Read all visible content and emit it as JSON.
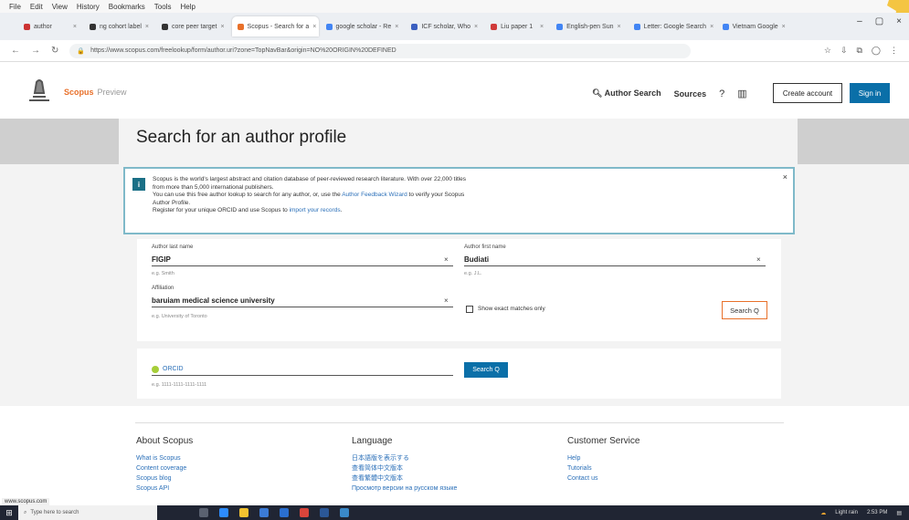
{
  "browser": {
    "menu": [
      "File",
      "Edit",
      "View",
      "History",
      "Bookmarks",
      "Tools",
      "Help"
    ],
    "tabs": [
      {
        "label": "author",
        "active": false
      },
      {
        "label": "ng cohort label",
        "active": false
      },
      {
        "label": "core peer target",
        "active": false
      },
      {
        "label": "Scopus - Search for a",
        "active": true
      },
      {
        "label": "google scholar - Re",
        "active": false
      },
      {
        "label": "ICF scholar, Who",
        "active": false
      },
      {
        "label": "Liu paper 1",
        "active": false
      },
      {
        "label": "English-pen Sun",
        "active": false
      },
      {
        "label": "Letter: Google Search",
        "active": false
      },
      {
        "label": "Vietnam Google",
        "active": false
      }
    ],
    "url": "https://www.scopus.com/freelookup/form/author.uri?zone=TopNavBar&origin=NO%20ORIGIN%20DEFINED"
  },
  "header": {
    "brand": "Scopus",
    "brand_sub": "Preview",
    "author_search": "Author Search",
    "sources": "Sources",
    "create_account": "Create account",
    "sign_in": "Sign in"
  },
  "page": {
    "title": "Search for an author profile"
  },
  "banner": {
    "line1": "Scopus is the world's largest abstract and citation database of peer-reviewed research literature. With over 22,000 titles",
    "line2": "from more than 5,000 international publishers.",
    "line3_pre": "You can use this free author lookup to search for any author, or, use the ",
    "line3_link": "Author Feedback Wizard",
    "line3_post": " to verify your Scopus",
    "line4": "Author Profile.",
    "line5_pre": "Register for your unique ORCID and use Scopus to ",
    "line5_link": "import your records",
    "line5_post": "."
  },
  "form": {
    "last_name_label": "Author last name",
    "last_name_value": "FIGIP",
    "last_name_hint": "e.g. Smith",
    "first_name_label": "Author first name",
    "first_name_value": "Budiati",
    "first_name_hint": "e.g. J.L.",
    "affiliation_label": "Affiliation",
    "affiliation_value": "baruiam medical science university",
    "affiliation_hint": "e.g. University of Toronto",
    "exact_match_label": "Show exact matches only",
    "search_button": "Search Q"
  },
  "orcid": {
    "label": "ORCID",
    "hint": "e.g. 1111-1111-1111-1111",
    "button": "Search Q"
  },
  "footer": {
    "col1": {
      "title": "About Scopus",
      "items": [
        "What is Scopus",
        "Content coverage",
        "Scopus blog",
        "Scopus API"
      ]
    },
    "col2": {
      "title": "Language",
      "items": [
        "日本語版を表示する",
        "查看简体中文版本",
        "查看繁體中文版本",
        "Просмотр версии на русском языке"
      ]
    },
    "col3": {
      "title": "Customer Service",
      "items": [
        "Help",
        "Tutorials",
        "Contact us"
      ]
    }
  },
  "status_url": "www.scopus.com",
  "taskbar": {
    "search_placeholder": "Type here to search",
    "tray_text": "Light rain",
    "time": "2:53 PM"
  },
  "colors": {
    "accent": "#e8702a",
    "primary": "#0a6fa8",
    "banner_border": "#7fb9c9",
    "orcid_green": "#a6ce39"
  }
}
